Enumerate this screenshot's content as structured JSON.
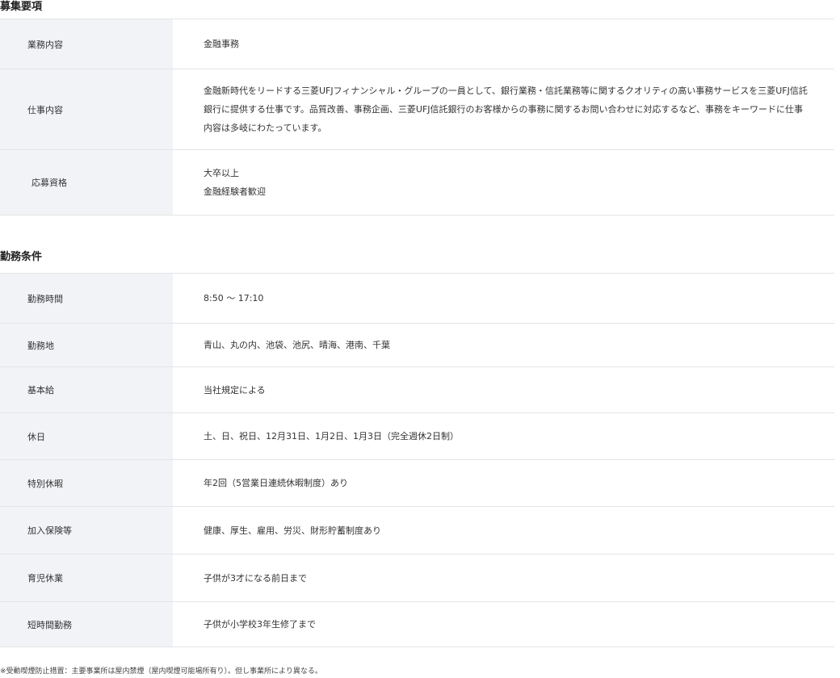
{
  "recruitment": {
    "title": "募集要項",
    "rows": [
      {
        "label": "業務内容",
        "lines": [
          "金融事務"
        ]
      },
      {
        "label": "仕事内容",
        "text": "金融新時代をリードする三菱UFJフィナンシャル・グループの一員として、銀行業務・信託業務等に関するクオリティの高い事務サービスを三菱UFJ信託銀行に提供する仕事です。品質改善、事務企画、三菱UFJ信託銀行のお客様からの事務に関するお問い合わせに対応するなど、事務をキーワードに仕事内容は多岐にわたっています。"
      },
      {
        "label": "応募資格",
        "lines": [
          "大卒以上",
          "金融経験者歓迎"
        ]
      }
    ]
  },
  "conditions": {
    "title": "勤務条件",
    "rows": [
      {
        "label": "勤務時間",
        "lines": [
          "8:50 〜 17:10"
        ]
      },
      {
        "label": "勤務地",
        "lines": [
          "青山、丸の内、池袋、池尻、晴海、港南、千葉"
        ]
      },
      {
        "label": "基本給",
        "lines": [
          "当社規定による"
        ]
      },
      {
        "label": "休日",
        "lines": [
          "土、日、祝日、12月31日、1月2日、1月3日（完全週休2日制）"
        ]
      },
      {
        "label": "特別休暇",
        "lines": [
          "年2回（5営業日連続休暇制度）あり"
        ]
      },
      {
        "label": "加入保険等",
        "lines": [
          "健康、厚生、雇用、労災、財形貯蓄制度あり"
        ]
      },
      {
        "label": "育児休業",
        "lines": [
          "子供が3才になる前日まで"
        ]
      },
      {
        "label": "短時間勤務",
        "lines": [
          "子供が小学校3年生修了まで"
        ]
      }
    ]
  },
  "footnote": "※受動喫煙防止措置：主要事業所は屋内禁煙（屋内喫煙可能場所有り）。但し事業所により異なる。"
}
